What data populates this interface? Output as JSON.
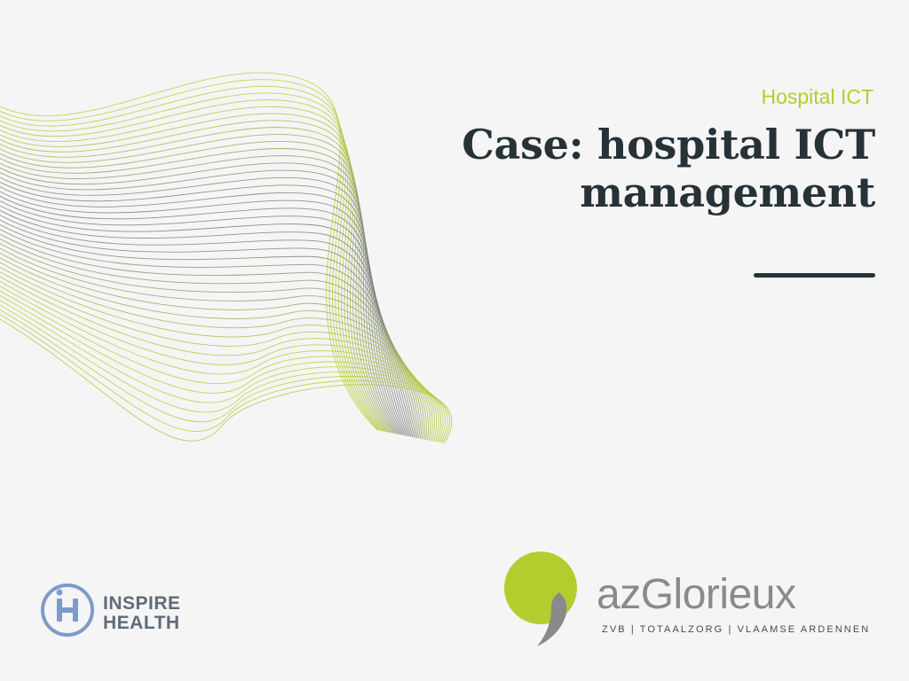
{
  "slide": {
    "eyebrow": "Hospital ICT",
    "title": "Case: hospital ICT management"
  },
  "partner_logo": {
    "name_line_1": "INSPIRE",
    "name_line_2": "HEALTH"
  },
  "hospital_logo": {
    "prefix": "az",
    "name": "Glorieux",
    "tagline": "ZVB | TOTAALZORG | VLAAMSE ARDENNEN"
  },
  "colors": {
    "background": "#f5f5f5",
    "title": "#263238",
    "accent_green": "#b5cc2e",
    "wave_green": "#b8cf3a",
    "wave_gray": "#7a7f80",
    "partner_blue": "#7f9ac9",
    "partner_text": "#5f6b7a",
    "hospital_gray": "#8a8a8a",
    "hospital_dark": "#4a4a4a",
    "rule": "#263238"
  }
}
